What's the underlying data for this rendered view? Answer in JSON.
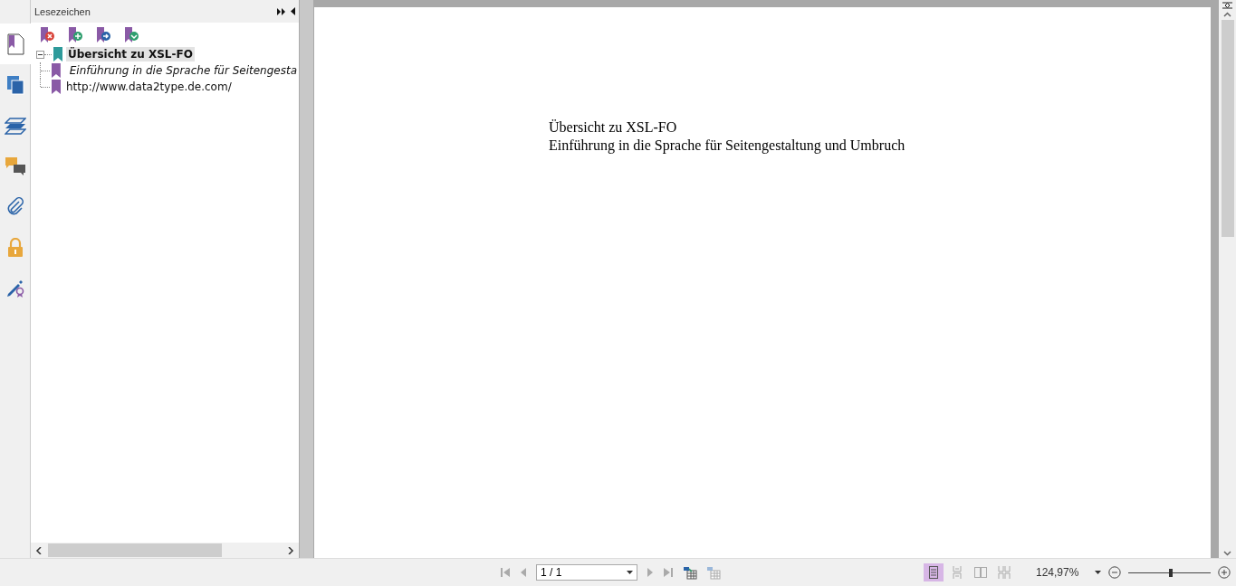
{
  "rail_tabs": [
    {
      "kind": "bookmarks",
      "selected": true
    },
    {
      "kind": "pages",
      "selected": false
    },
    {
      "kind": "layers",
      "selected": false
    },
    {
      "kind": "comments",
      "selected": false
    },
    {
      "kind": "attachments",
      "selected": false
    },
    {
      "kind": "security",
      "selected": false
    },
    {
      "kind": "signatures",
      "selected": false
    }
  ],
  "panel": {
    "title": "Lesezeichen",
    "bookmarks": [
      {
        "label": "Übersicht zu XSL-FO",
        "selected": true,
        "expanded": true,
        "italic": false,
        "children": [
          {
            "label": "Einführung in die Sprache für Seitengesta",
            "selected": false,
            "italic": true
          },
          {
            "label": "http://www.data2type.de.com/",
            "selected": false,
            "italic": false
          }
        ]
      }
    ]
  },
  "document": {
    "lines": [
      "Übersicht zu XSL-FO",
      "Einführung in die Sprache für Seitengestaltung und Umbruch"
    ]
  },
  "status_bar": {
    "page_field": "1 / 1",
    "view_modes": [
      {
        "kind": "single",
        "selected": true
      },
      {
        "kind": "continuous",
        "selected": false
      },
      {
        "kind": "facing",
        "selected": false
      },
      {
        "kind": "continuous-facing",
        "selected": false
      }
    ],
    "zoom": "124,97%",
    "zoom_slider": {
      "level": 0.52
    }
  }
}
